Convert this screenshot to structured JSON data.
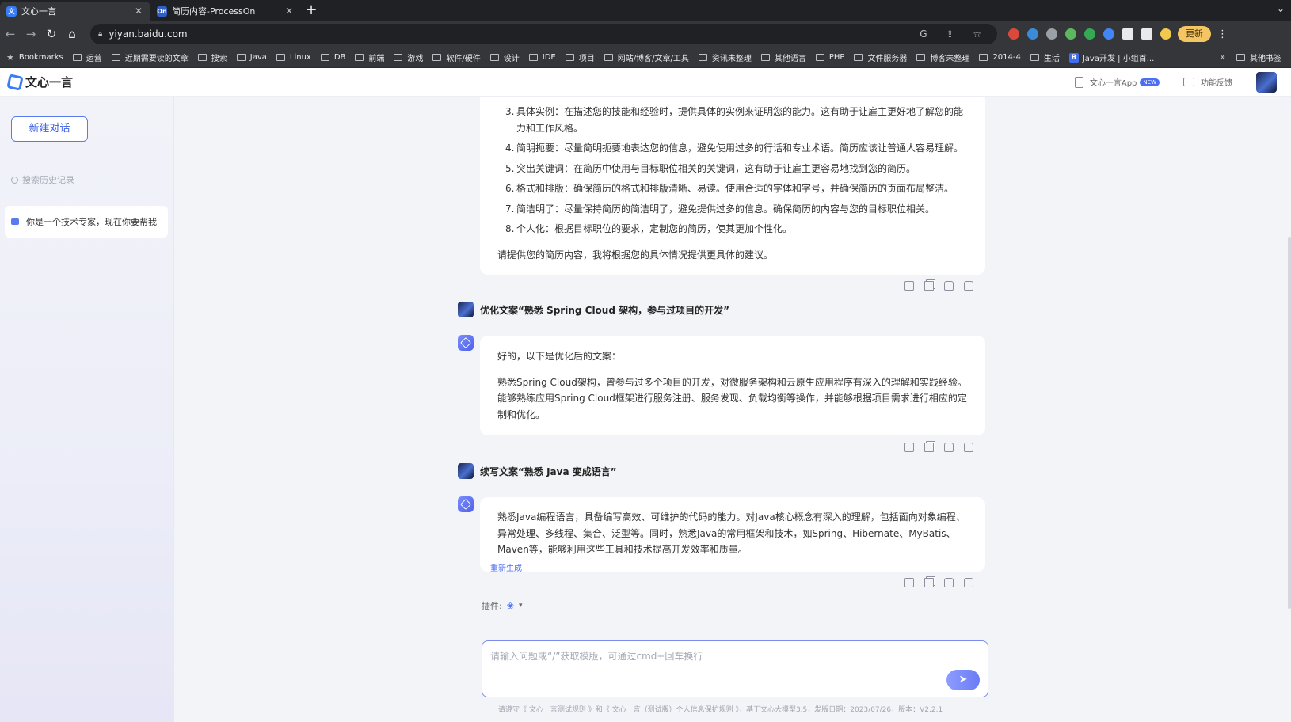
{
  "browser": {
    "tabs": [
      {
        "title": "文心一言",
        "favicon": "文",
        "active": true
      },
      {
        "title": "简历内容-ProcessOn",
        "favicon": "On",
        "active": false
      }
    ],
    "url": "yiyan.baidu.com",
    "update_label": "更新",
    "bookmarks": [
      "Bookmarks",
      "运营",
      "近期需要读的文章",
      "搜索",
      "Java",
      "Linux",
      "DB",
      "前端",
      "游戏",
      "软件/硬件",
      "设计",
      "IDE",
      "项目",
      "网站/博客/文章/工具",
      "资讯未整理",
      "其他语言",
      "PHP",
      "文件服务器",
      "博客未整理",
      "2014-4",
      "生活",
      "Java开发 | 小组首..."
    ],
    "bookmarks_more": "其他书签"
  },
  "app": {
    "logo_text": "文心一言",
    "app_link": "文心一言App",
    "new_badge": "NEW",
    "feedback": "功能反馈"
  },
  "sidebar": {
    "new_chat": "新建对话",
    "search_placeholder": "搜索历史记录",
    "history": [
      "你是一个技术专家，现在你要帮我"
    ]
  },
  "conversation": {
    "tips": [
      {
        "num": "3.",
        "text": "具体实例：在描述您的技能和经验时，提供具体的实例来证明您的能力。这有助于让雇主更好地了解您的能力和工作风格。"
      },
      {
        "num": "4.",
        "text": "简明扼要：尽量简明扼要地表达您的信息，避免使用过多的行话和专业术语。简历应该让普通人容易理解。"
      },
      {
        "num": "5.",
        "text": "突出关键词：在简历中使用与目标职位相关的关键词，这有助于让雇主更容易地找到您的简历。"
      },
      {
        "num": "6.",
        "text": "格式和排版：确保简历的格式和排版清晰、易读。使用合适的字体和字号，并确保简历的页面布局整洁。"
      },
      {
        "num": "7.",
        "text": "简洁明了：尽量保持简历的简洁明了，避免提供过多的信息。确保简历的内容与您的目标职位相关。"
      },
      {
        "num": "8.",
        "text": "个人化：根据目标职位的要求，定制您的简历，使其更加个性化。"
      }
    ],
    "tips_closing": "请提供您的简历内容，我将根据您的具体情况提供更具体的建议。",
    "user_msg_1": "优化文案“熟悉 Spring Cloud 架构，参与过项目的开发”",
    "bot_reply_1_intro": "好的，以下是优化后的文案：",
    "bot_reply_1_body": "熟悉Spring Cloud架构，曾参与过多个项目的开发，对微服务架构和云原生应用程序有深入的理解和实践经验。能够熟练应用Spring Cloud框架进行服务注册、服务发现、负载均衡等操作，并能够根据项目需求进行相应的定制和优化。",
    "user_msg_2": "续写文案“熟悉 Java 变成语言”",
    "bot_reply_2": "熟悉Java编程语言，具备编写高效、可维护的代码的能力。对Java核心概念有深入的理解，包括面向对象编程、异常处理、多线程、集合、泛型等。同时，熟悉Java的常用框架和技术，如Spring、Hibernate、MyBatis、Maven等，能够利用这些工具和技术提高开发效率和质量。",
    "regenerate": "重新生成"
  },
  "composer": {
    "plugin_label": "插件:",
    "placeholder": "请输入问题或“/”获取模版，可通过cmd+回车换行"
  },
  "footer": "请遵守《 文心一言测试规则 》和《 文心一言（测试版）个人信息保护规则 》，基于文心大模型3.5，发版日期：2023/07/26，版本：V2.2.1",
  "colors": {
    "accent": "#4e6ef2",
    "sidebar_bg": "#ecedf8",
    "chrome_bg": "#35363a"
  }
}
